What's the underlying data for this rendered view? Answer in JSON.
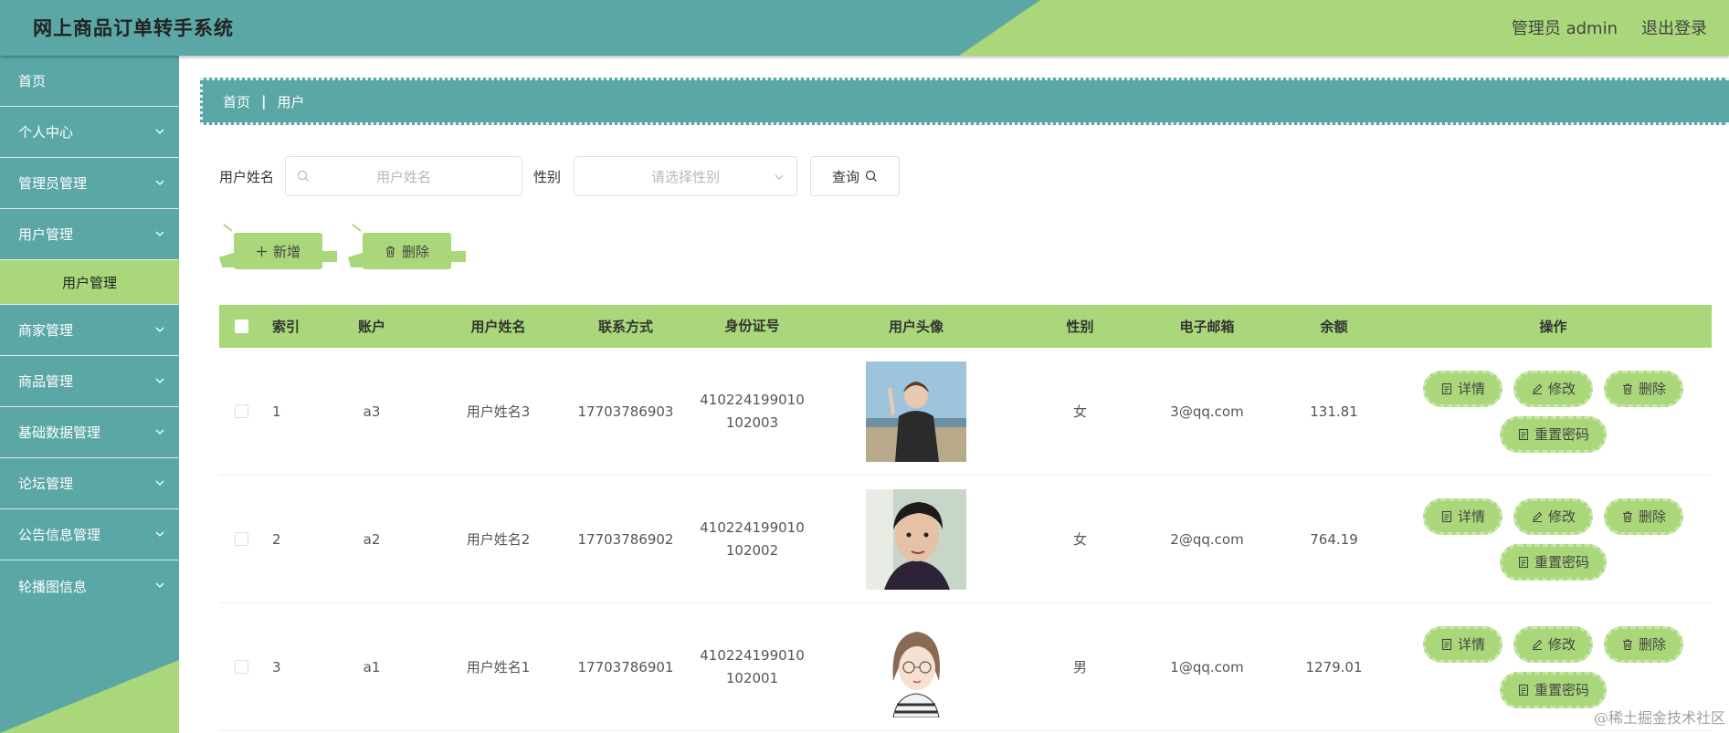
{
  "header": {
    "title": "网上商品订单转手系统",
    "user": "管理员 admin",
    "logout": "退出登录"
  },
  "sidebar": {
    "items": [
      {
        "label": "首页"
      },
      {
        "label": "个人中心"
      },
      {
        "label": "管理员管理"
      },
      {
        "label": "用户管理"
      },
      {
        "label": "商家管理"
      },
      {
        "label": "商品管理"
      },
      {
        "label": "基础数据管理"
      },
      {
        "label": "论坛管理"
      },
      {
        "label": "公告信息管理"
      },
      {
        "label": "轮播图信息"
      }
    ],
    "active_sub": "用户管理"
  },
  "breadcrumb": {
    "home": "首页",
    "current": "用户"
  },
  "search": {
    "name_label": "用户姓名",
    "name_placeholder": "用户姓名",
    "sex_label": "性别",
    "sex_placeholder": "请选择性别",
    "query_label": "查询"
  },
  "actions": {
    "add": "新增",
    "delete": "删除"
  },
  "table": {
    "headers": [
      "索引",
      "账户",
      "用户姓名",
      "联系方式",
      "身份证号",
      "用户头像",
      "性别",
      "电子邮箱",
      "余额",
      "操作"
    ],
    "rows": [
      {
        "index": "1",
        "account": "a3",
        "name": "用户姓名3",
        "phone": "17703786903",
        "id_a": "410224199010",
        "id_b": "102003",
        "sex": "女",
        "email": "3@qq.com",
        "balance": "131.81"
      },
      {
        "index": "2",
        "account": "a2",
        "name": "用户姓名2",
        "phone": "17703786902",
        "id_a": "410224199010",
        "id_b": "102002",
        "sex": "女",
        "email": "2@qq.com",
        "balance": "764.19"
      },
      {
        "index": "3",
        "account": "a1",
        "name": "用户姓名1",
        "phone": "17703786901",
        "id_a": "410224199010",
        "id_b": "102001",
        "sex": "男",
        "email": "1@qq.com",
        "balance": "1279.01"
      }
    ],
    "ops": {
      "detail": "详情",
      "edit": "修改",
      "delete": "删除",
      "reset": "重置密码"
    }
  },
  "watermark": "@稀土掘金技术社区",
  "colors": {
    "teal": "#5aa7a6",
    "green": "#a9d779"
  }
}
